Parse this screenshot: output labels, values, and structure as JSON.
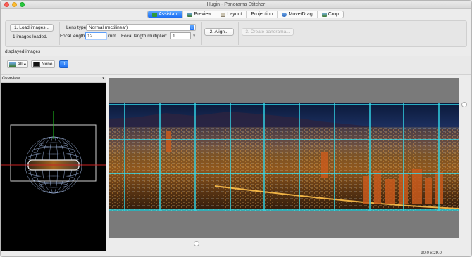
{
  "window": {
    "title": "Hugin - Panorama Stitcher"
  },
  "tabs": [
    {
      "label": "Assistant",
      "icon": "assistant-icon",
      "active": true
    },
    {
      "label": "Preview",
      "icon": "preview-icon",
      "active": false
    },
    {
      "label": "Layout",
      "icon": "layout-icon",
      "active": false
    },
    {
      "label": "Projection",
      "icon": "",
      "active": false
    },
    {
      "label": "Move/Drag",
      "icon": "move-drag-icon",
      "active": false
    },
    {
      "label": "Crop",
      "icon": "crop-icon",
      "active": false
    }
  ],
  "assistant": {
    "load_button": "1. Load images...",
    "images_loaded": "1 images loaded.",
    "lens_type_label": "Lens type:",
    "lens_type_value": "Normal (rectilinear)",
    "focal_length_label": "Focal length:",
    "focal_length_value": "12",
    "focal_length_unit": "mm",
    "multiplier_label": "Focal length multiplier:",
    "multiplier_value": "1",
    "multiplier_unit": "x",
    "align_button": "2. Align...",
    "create_button": "3. Create panorama..."
  },
  "displayed_images": {
    "label": "displayed images",
    "all_label": "All",
    "none_label": "None",
    "image_button": "0"
  },
  "overview": {
    "label": "Overview",
    "close": "x"
  },
  "status": {
    "fov": "90.0 x 29.0"
  },
  "colors": {
    "accent": "#1c6ef2",
    "grid": "#33ddee",
    "overview_h": "#cc2222",
    "overview_v": "#22cc22"
  }
}
